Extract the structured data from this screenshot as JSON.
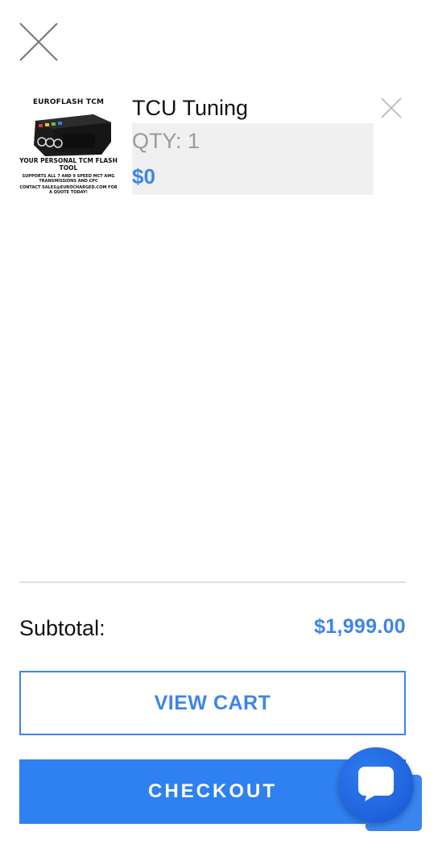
{
  "drawer": {
    "close_icon": "close-icon"
  },
  "cart_item": {
    "name": "TCU Tuning",
    "qty_text": "QTY: 1",
    "price": "$0",
    "remove_icon": "close-icon",
    "image": {
      "brand": "EUROFLASH TCM",
      "tagline": "YOUR PERSONAL TCM FLASH TOOL",
      "supports": "SUPPORTS ALL 7 AND 9 SPEED MCT AMG TRANSMISSIONS AND CPC",
      "contact": "CONTACT SALES@EUROCHARGED.COM FOR A QUOTE TODAY!"
    }
  },
  "summary": {
    "subtotal_label": "Subtotal:",
    "subtotal_value": "$1,999.00"
  },
  "actions": {
    "view_cart_label": "VIEW CART",
    "checkout_label": "CHECKOUT"
  },
  "chat": {
    "icon": "chat-bubble-icon"
  },
  "colors": {
    "accent": "#3d85e8",
    "checkout_bg": "#2f80f0",
    "chat_bg": "#1f60dc",
    "qty_text": "#9a9a9a",
    "details_bg": "#f0f0f0"
  }
}
